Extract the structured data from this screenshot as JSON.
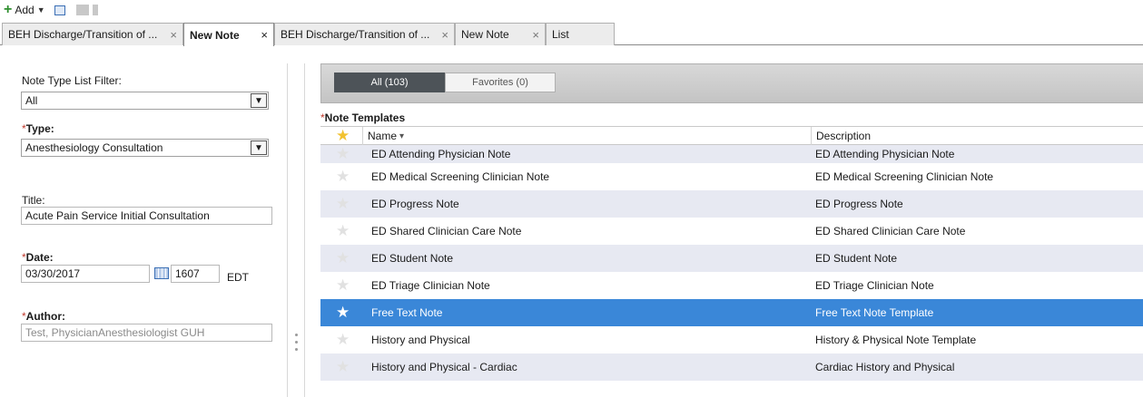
{
  "toolbar": {
    "add_label": "Add"
  },
  "tabs": [
    {
      "label": "BEH Discharge/Transition of ...",
      "active": false
    },
    {
      "label": "New Note",
      "active": true
    },
    {
      "label": "BEH Discharge/Transition of ...",
      "active": false
    },
    {
      "label": "New Note",
      "active": false
    },
    {
      "label": "List",
      "active": false
    }
  ],
  "form": {
    "note_type_filter": {
      "label": "Note Type List Filter:",
      "value": "All"
    },
    "type": {
      "required_mark": "*",
      "label": "Type:",
      "value": "Anesthesiology Consultation"
    },
    "title": {
      "label": "Title:",
      "value": "Acute Pain Service Initial Consultation"
    },
    "date": {
      "required_mark": "*",
      "label": "Date:",
      "value": "03/30/2017",
      "time": "1607",
      "timezone": "EDT"
    },
    "author": {
      "required_mark": "*",
      "label": "Author:",
      "value": "Test, PhysicianAnesthesiologist GUH"
    }
  },
  "filters": {
    "all_label": "All (103)",
    "favorites_label": "Favorites (0)",
    "active": "all"
  },
  "templates": {
    "required_mark": "*",
    "title": "Note Templates",
    "columns": {
      "name": "Name",
      "name_sort": "▾",
      "description": "Description"
    },
    "rows": [
      {
        "name": "ED Attending Physician Note",
        "description": "ED Attending Physician Note",
        "favorite": false,
        "selected": false
      },
      {
        "name": "ED Medical Screening Clinician Note",
        "description": "ED Medical Screening Clinician Note",
        "favorite": false,
        "selected": false
      },
      {
        "name": "ED Progress Note",
        "description": "ED Progress Note",
        "favorite": false,
        "selected": false
      },
      {
        "name": "ED Shared Clinician Care Note",
        "description": "ED Shared Clinician Care Note",
        "favorite": false,
        "selected": false
      },
      {
        "name": "ED Student Note",
        "description": "ED Student Note",
        "favorite": false,
        "selected": false
      },
      {
        "name": "ED Triage Clinician Note",
        "description": "ED Triage Clinician Note",
        "favorite": false,
        "selected": false
      },
      {
        "name": "Free Text Note",
        "description": "Free Text Note Template",
        "favorite": false,
        "selected": true
      },
      {
        "name": "History and Physical",
        "description": "History & Physical Note Template",
        "favorite": false,
        "selected": false
      },
      {
        "name": "History and Physical - Cardiac",
        "description": "Cardiac History and Physical",
        "favorite": false,
        "selected": false
      }
    ]
  },
  "colors": {
    "selected_row": "#3a87d8",
    "shaded_row": "#e7e9f2",
    "required": "#c0392b",
    "segment_active": "#4d5358"
  }
}
